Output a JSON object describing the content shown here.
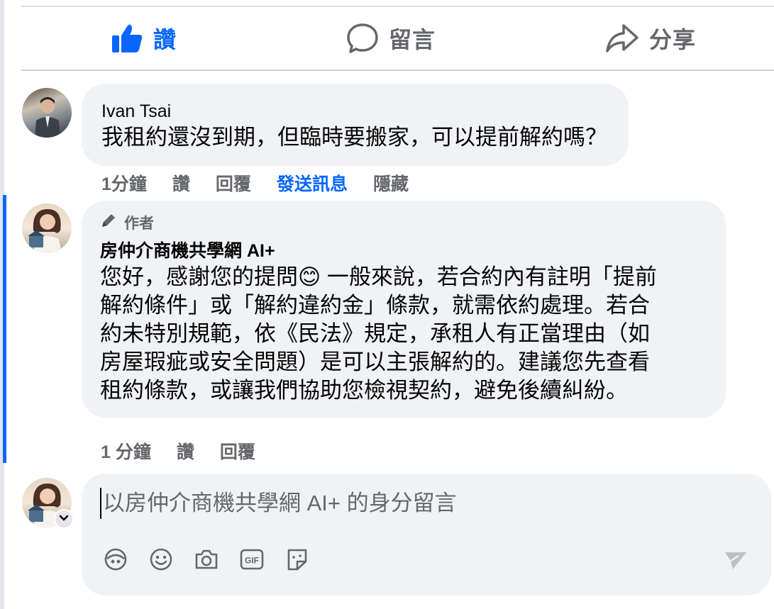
{
  "actions": {
    "like_label": "讚",
    "comment_label": "留言",
    "share_label": "分享"
  },
  "comments": [
    {
      "author": "Ivan Tsai",
      "text": "我租約還沒到期，但臨時要搬家，可以提前解約嗎？",
      "meta": {
        "time": "1分鐘",
        "like": "讚",
        "reply": "回覆",
        "send_message": "發送訊息",
        "hide": "隱藏"
      }
    },
    {
      "badge": "作者",
      "author": "房仲介商機共學網 AI+",
      "lines": [
        "您好，感謝您的提問😊 一般來說，若合約內有註明「提前",
        "解約條件」或「解約違約金」條款，就需依約處理。若合",
        "約未特別規範，依《民法》規定，承租人有正當理由（如",
        "房屋瑕疵或安全問題）是可以主張解約的。建議您先查看",
        "租約條款，或讓我們協助您檢視契約，避免後續糾紛。"
      ],
      "meta": {
        "time": "1 分鐘",
        "like": "讚",
        "reply": "回覆"
      }
    }
  ],
  "composer": {
    "placeholder": "以房仲介商機共學網 AI+ 的身分留言",
    "icons": [
      "avatar-sticker-icon",
      "emoji-icon",
      "camera-icon",
      "gif-icon",
      "sticker-icon"
    ]
  },
  "colors": {
    "accent": "#0866ff",
    "bubble": "#f0f2f5",
    "muted": "#65676b"
  }
}
